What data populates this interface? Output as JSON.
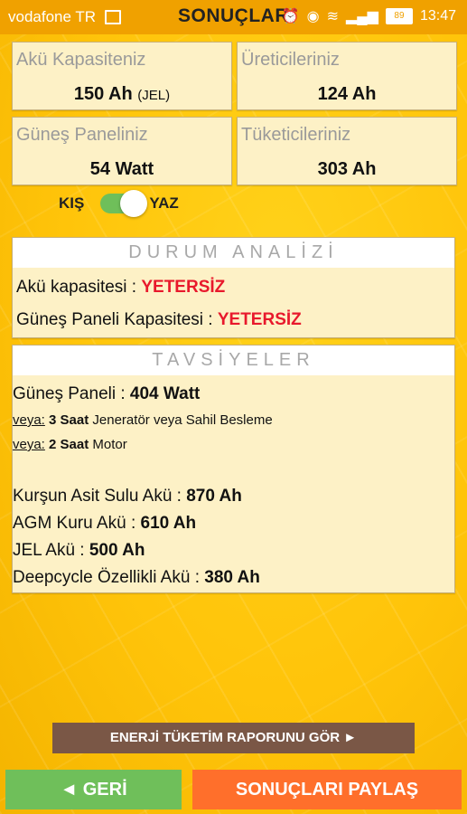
{
  "status_bar": {
    "carrier": "vodafone TR",
    "title": "SONUÇLAR",
    "time": "13:47",
    "battery": "89",
    "icons": [
      "image-icon",
      "alarm-icon",
      "eye-icon",
      "wifi-icon",
      "signal-icon",
      "battery-icon"
    ]
  },
  "cards": {
    "battery_capacity": {
      "label": "Akü Kapasiteniz",
      "value": "150 Ah",
      "suffix": "(JEL)"
    },
    "producers": {
      "label": "Üreticileriniz",
      "value": "124 Ah"
    },
    "solar_panel": {
      "label": "Güneş Paneliniz",
      "value": "54 Watt"
    },
    "consumers": {
      "label": "Tüketicileriniz",
      "value": "303 Ah"
    }
  },
  "season_toggle": {
    "left_label": "KIŞ",
    "right_label": "YAZ",
    "selected": "YAZ"
  },
  "analysis": {
    "title": "DURUM ANALİZİ",
    "battery_label": "Akü kapasitesi :",
    "battery_status": "YETERSİZ",
    "panel_label": "Güneş Paneli Kapasitesi :",
    "panel_status": "YETERSİZ"
  },
  "recommendations": {
    "title": "TAVSİYELER",
    "panel_label": "Güneş Paneli :",
    "panel_value": "404 Watt",
    "or1_prefix": "veya:",
    "or1_value": "3 Saat",
    "or1_text": "Jeneratör veya Sahil Besleme",
    "or2_prefix": "veya:",
    "or2_value": "2 Saat",
    "or2_text": "Motor",
    "lead_acid_label": "Kurşun Asit Sulu Akü :",
    "lead_acid_value": "870 Ah",
    "agm_label": "AGM Kuru Akü :",
    "agm_value": "610 Ah",
    "gel_label": "JEL Akü :",
    "gel_value": "500 Ah",
    "deepcycle_label": "Deepcycle Özellikli Akü :",
    "deepcycle_value": "380 Ah"
  },
  "buttons": {
    "report": "ENERJİ TÜKETİM RAPORUNU GÖR ►",
    "back": "◄ GERİ",
    "share": "SONUÇLARI PAYLAŞ"
  },
  "colors": {
    "status_bar": "#f0a100",
    "card_bg": "#fdf1c6",
    "alert_red": "#e8192c",
    "toggle_green": "#6fbf5a",
    "report_brown": "#7a5746",
    "share_orange": "#ff6f2b"
  }
}
